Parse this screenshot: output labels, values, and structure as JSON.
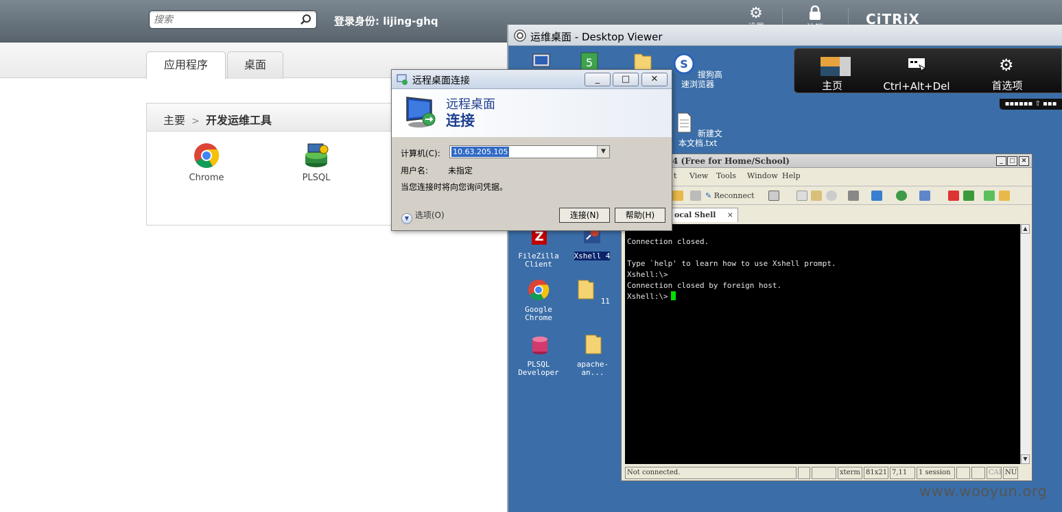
{
  "portal": {
    "search_placeholder": "搜索",
    "login_label": "登录身份: lijing-ghq",
    "settings_label": "设置",
    "logout_label": "注销",
    "brand": "CiTRiX",
    "tabs": [
      {
        "label": "应用程序"
      },
      {
        "label": "桌面"
      }
    ],
    "breadcrumb": {
      "home": "主要",
      "sep": ">",
      "current": "开发运维工具"
    },
    "apps": [
      {
        "label": "Chrome"
      },
      {
        "label": "PLSQL"
      }
    ]
  },
  "rdp": {
    "title": "远程桌面连接",
    "header_line1": "远程桌面",
    "header_line2": "连接",
    "computer_label": "计算机(C):",
    "computer_value": "10.63.205.105",
    "user_label": "用户名:",
    "user_value": "未指定",
    "note": "当您连接时将向您询问凭据。",
    "options_label": "选项(O)",
    "connect_label": "连接(N)",
    "help_label": "帮助(H)",
    "min": "_",
    "max": "□",
    "close": "✕"
  },
  "viewer": {
    "title": "运维桌面 - Desktop Viewer",
    "toolbar": [
      {
        "label": "主页"
      },
      {
        "label": "Ctrl+Alt+Del"
      },
      {
        "label": "首选项"
      }
    ],
    "mini_bar": "▪▪▪▪▪▪ ⇧ ▪▪▪",
    "desktop_icons": {
      "sogou": "搜狗高速浏览器",
      "txt": "新建文本文档.txt",
      "filezilla": "FileZilla Client",
      "xshell": "Xshell 4",
      "chrome": "Google Chrome",
      "folder11": "11",
      "plsql": "PLSQL Developer",
      "apache": "apache-an..."
    }
  },
  "xshell": {
    "title": "4 (Free for Home/School)",
    "menu": [
      "t",
      "View",
      "Tools",
      "Window",
      "Help"
    ],
    "reconnect": "Reconnect",
    "tab": "ocal Shell",
    "tab_close": "×",
    "lines": [
      "Connection closed.",
      "",
      "Type `help' to learn how to use Xshell prompt.",
      "Xshell:\\>",
      "Connection closed by foreign host."
    ],
    "prompt": "Xshell:\\>",
    "status": {
      "conn": "Not connected.",
      "term": "xterm",
      "size": "81x21",
      "pos": "7,11",
      "sessions": "1 session",
      "cap": "CAP",
      "num": "NUM"
    }
  },
  "watermark": "www.wooyun.org"
}
